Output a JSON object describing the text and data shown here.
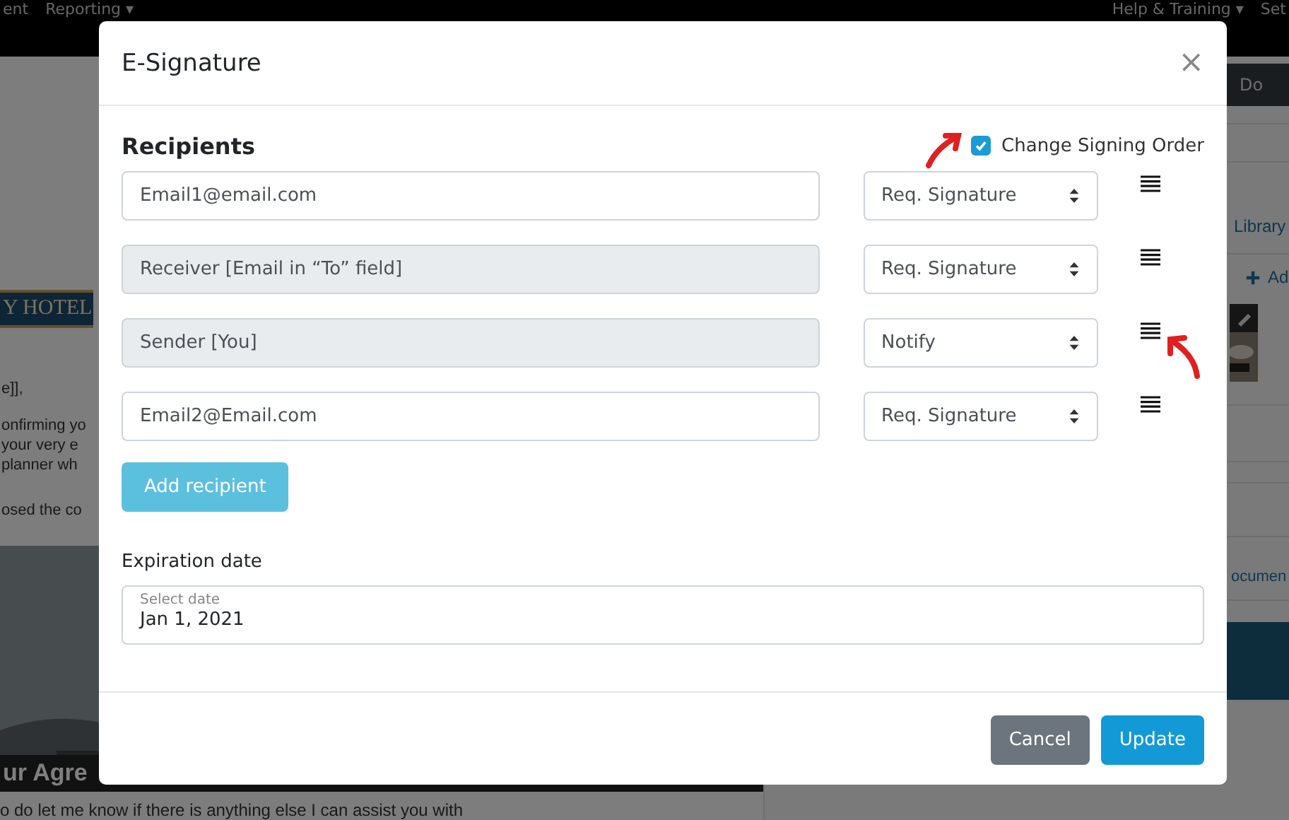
{
  "top_nav": {
    "left_items": [
      {
        "label": "ent"
      },
      {
        "label": "Reporting ▾"
      }
    ],
    "right_items": [
      {
        "label": "Help & Training ▾"
      },
      {
        "label": "Set"
      }
    ]
  },
  "document": {
    "logo_text": "Y HOTEL",
    "lines": [
      "e]],",
      "onfirming yo",
      "your very e",
      "planner wh",
      "osed the co"
    ],
    "banner": {
      "kind": "picture",
      "caption": "ur Agre"
    },
    "footer_line": "o do let me know if there is anything else I can assist you with"
  },
  "side_panel": {
    "header": "Do",
    "library_link": "Library",
    "add_link": "Ad",
    "documents_link": "ocumen"
  },
  "modal": {
    "title": "E-Signature",
    "close": "×",
    "section_title": "Recipients",
    "signing_order": {
      "label": "Change Signing Order",
      "checked": true
    },
    "recipients": [
      {
        "value": "Email1@email.com",
        "readonly": false,
        "role": "Req. Signature"
      },
      {
        "value": "Receiver [Email in “To” field]",
        "readonly": true,
        "role": "Req. Signature"
      },
      {
        "value": "Sender [You]",
        "readonly": true,
        "role": "Notify"
      },
      {
        "value": "Email2@Email.com",
        "readonly": false,
        "role": "Req. Signature"
      }
    ],
    "add_button": "Add recipient",
    "expiration": {
      "label": "Expiration date",
      "field_label": "Select date",
      "value": "Jan 1, 2021"
    },
    "buttons": [
      {
        "label": "Cancel",
        "kind": "secondary"
      },
      {
        "label": "Update",
        "kind": "primary"
      }
    ]
  }
}
